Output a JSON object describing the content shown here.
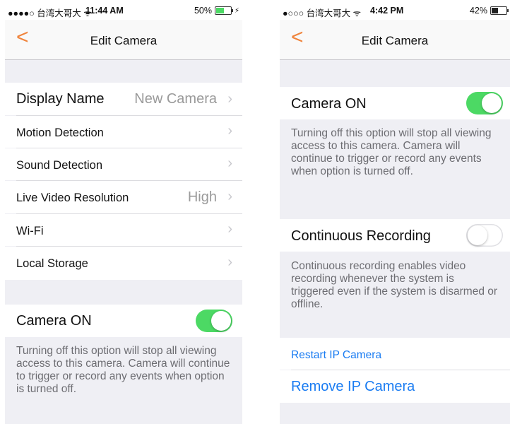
{
  "left_screen": {
    "status": {
      "carrier": "●●●●○ 台湾大哥大 ᯤ",
      "time": "11:44 AM",
      "battery": "50%",
      "charging": "⚡",
      "battery_level": 0.5
    },
    "nav": {
      "back": "<",
      "title": "Edit Camera"
    },
    "rows": {
      "display_name": {
        "label": "Display Name",
        "value": "New Camera"
      },
      "motion": {
        "label": "Motion Detection"
      },
      "sound": {
        "label": "Sound Detection"
      },
      "resolution": {
        "label": "Live Video Resolution",
        "value": "High"
      },
      "wifi": {
        "label": "Wi-Fi"
      },
      "storage": {
        "label": "Local Storage"
      },
      "camera_on": {
        "label": "Camera ON",
        "on": true
      }
    },
    "camera_on_description": "Turning off this option will stop all viewing access to this camera. Camera will continue to trigger or record any events when option is turned off."
  },
  "right_screen": {
    "status": {
      "carrier": "●○○○ 台湾大哥大 ᯤ",
      "time": "4:42 PM",
      "battery": "42%",
      "battery_level": 0.42
    },
    "nav": {
      "back": "<",
      "title": "Edit Camera"
    },
    "camera_on": {
      "label": "Camera ON",
      "on": true
    },
    "camera_on_description": "Turning off this option will stop all viewing access to this camera. Camera will continue to trigger or record any events when option is turned off.",
    "continuous": {
      "label": "Continuous Recording",
      "on": false
    },
    "continuous_description": "Continuous recording enables video recording whenever the system is triggered even if the system is disarmed or offline.",
    "restart_label": "Restart IP Camera",
    "remove_label": "Remove IP Camera"
  },
  "colors": {
    "accent": "#f0843c",
    "toggle_on": "#4cd964",
    "link": "#1a7cf2"
  }
}
